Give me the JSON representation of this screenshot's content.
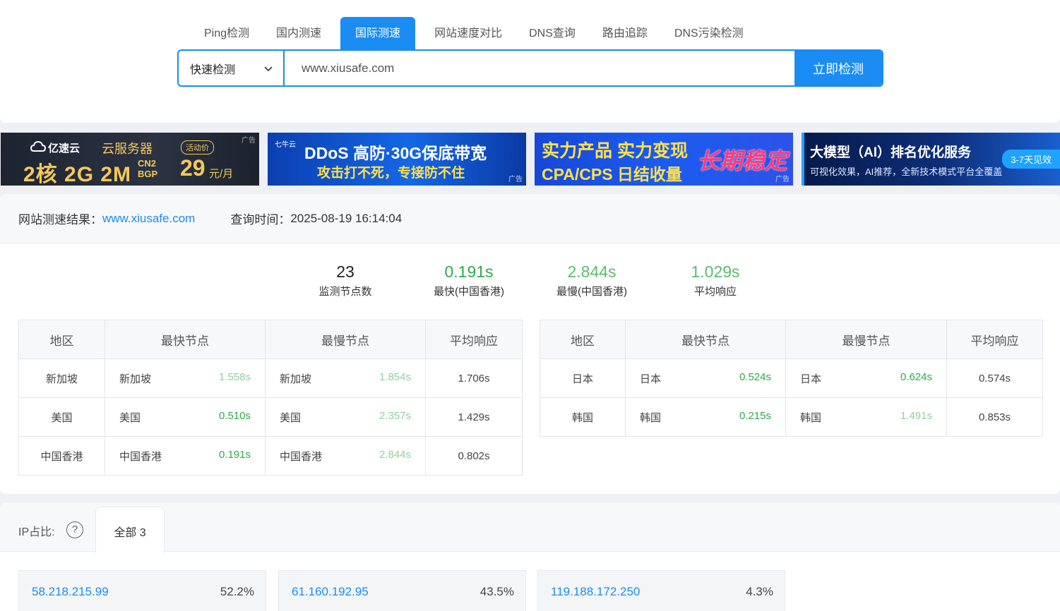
{
  "tabs": [
    {
      "label": "Ping检测",
      "active": false
    },
    {
      "label": "国内测速",
      "active": false
    },
    {
      "label": "国际测速",
      "active": true
    },
    {
      "label": "网站速度对比",
      "active": false
    },
    {
      "label": "DNS查询",
      "active": false
    },
    {
      "label": "路由追踪",
      "active": false
    },
    {
      "label": "DNS污染检测",
      "active": false
    }
  ],
  "search": {
    "mode": "快速检测",
    "value": "www.xiusafe.com",
    "button": "立即检测"
  },
  "ads": {
    "tag": "广告",
    "ad1": {
      "brand": "亿速云",
      "product": "云服务器",
      "badge": "活动价",
      "spec": "2核 2G 2M",
      "net_line1": "CN2",
      "net_line2": "BGP",
      "price": "29",
      "unit": "元/月"
    },
    "ad2": {
      "brand": "七牛云",
      "headline": "DDoS 高防·30G保底带宽",
      "sub": "攻击打不死，专接防不住"
    },
    "ad3": {
      "headline": "实力产品 实力变现",
      "sub": "CPA/CPS 日结收量",
      "slogan": "长期稳定"
    },
    "ad4": {
      "headline": "大模型（AI）排名优化服务",
      "sub": "可视化效果，AI推荐，全新技术模式平台全覆盖",
      "badge": "3-7天见效"
    }
  },
  "result": {
    "label": "网站测速结果：",
    "site": "www.xiusafe.com",
    "time_label": "查询时间：",
    "time": "2025-08-19 16:14:04"
  },
  "stats": [
    {
      "value": "23",
      "label": "监测节点数"
    },
    {
      "value": "0.191s",
      "label": "最快(中国香港)"
    },
    {
      "value": "2.844s",
      "label": "最慢(中国香港)"
    },
    {
      "value": "1.029s",
      "label": "平均响应"
    }
  ],
  "table_headers": [
    "地区",
    "最快节点",
    "最慢节点",
    "平均响应"
  ],
  "table_left": [
    {
      "region": "新加坡",
      "fast_node": "新加坡",
      "fast": "1.558s",
      "slow_node": "新加坡",
      "slow": "1.854s",
      "avg": "1.706s"
    },
    {
      "region": "美国",
      "fast_node": "美国",
      "fast": "0.510s",
      "slow_node": "美国",
      "slow": "2.357s",
      "avg": "1.429s"
    },
    {
      "region": "中国香港",
      "fast_node": "中国香港",
      "fast": "0.191s",
      "slow_node": "中国香港",
      "slow": "2.844s",
      "avg": "0.802s"
    }
  ],
  "table_right": [
    {
      "region": "日本",
      "fast_node": "日本",
      "fast": "0.524s",
      "slow_node": "日本",
      "slow": "0.624s",
      "avg": "0.574s"
    },
    {
      "region": "韩国",
      "fast_node": "韩国",
      "fast": "0.215s",
      "slow_node": "韩国",
      "slow": "1.491s",
      "avg": "0.853s"
    }
  ],
  "ip": {
    "label": "IP占比:",
    "help": "?",
    "tab": "全部 3",
    "items": [
      {
        "ip": "58.218.215.99",
        "pct": "52.2%"
      },
      {
        "ip": "61.160.192.95",
        "pct": "43.5%"
      },
      {
        "ip": "119.188.172.250",
        "pct": "4.3%"
      }
    ]
  },
  "colors": {
    "accent": "#1a8cf3",
    "fast_green": "#2ea84c",
    "mid_green": "#5bbc6e",
    "light_green": "#8fd09c"
  }
}
